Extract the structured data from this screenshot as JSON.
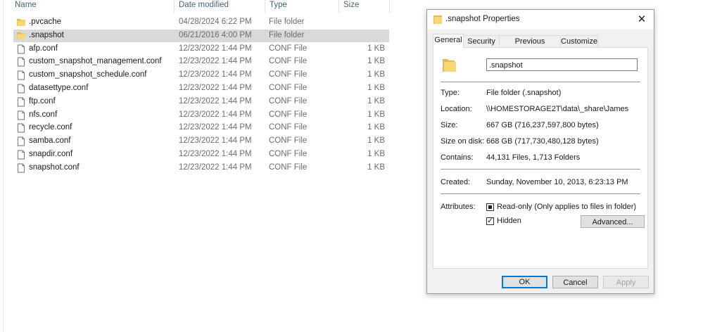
{
  "explorer": {
    "columns": {
      "name": "Name",
      "date": "Date modified",
      "type": "Type",
      "size": "Size"
    },
    "rows": [
      {
        "name": ".pvcache",
        "date": "04/28/2024 6:22 PM",
        "type": "File folder",
        "size": "",
        "icon": "folder-icon"
      },
      {
        "name": ".snapshot",
        "date": "06/21/2016 4:00 PM",
        "type": "File folder",
        "size": "",
        "icon": "folder-icon",
        "selected": true
      },
      {
        "name": "afp.conf",
        "date": "12/23/2022 1:44 PM",
        "type": "CONF File",
        "size": "1 KB",
        "icon": "file-icon"
      },
      {
        "name": "custom_snapshot_management.conf",
        "date": "12/23/2022 1:44 PM",
        "type": "CONF File",
        "size": "1 KB",
        "icon": "file-icon"
      },
      {
        "name": "custom_snapshot_schedule.conf",
        "date": "12/23/2022 1:44 PM",
        "type": "CONF File",
        "size": "1 KB",
        "icon": "file-icon"
      },
      {
        "name": "datasettype.conf",
        "date": "12/23/2022 1:44 PM",
        "type": "CONF File",
        "size": "1 KB",
        "icon": "file-icon"
      },
      {
        "name": "ftp.conf",
        "date": "12/23/2022 1:44 PM",
        "type": "CONF File",
        "size": "1 KB",
        "icon": "file-icon"
      },
      {
        "name": "nfs.conf",
        "date": "12/23/2022 1:44 PM",
        "type": "CONF File",
        "size": "1 KB",
        "icon": "file-icon"
      },
      {
        "name": "recycle.conf",
        "date": "12/23/2022 1:44 PM",
        "type": "CONF File",
        "size": "1 KB",
        "icon": "file-icon"
      },
      {
        "name": "samba.conf",
        "date": "12/23/2022 1:44 PM",
        "type": "CONF File",
        "size": "1 KB",
        "icon": "file-icon"
      },
      {
        "name": "snapdir.conf",
        "date": "12/23/2022 1:44 PM",
        "type": "CONF File",
        "size": "1 KB",
        "icon": "file-icon"
      },
      {
        "name": "snapshot.conf",
        "date": "12/23/2022 1:44 PM",
        "type": "CONF File",
        "size": "1 KB",
        "icon": "file-icon"
      }
    ]
  },
  "dialog": {
    "title": ".snapshot Properties",
    "close_icon": "close-icon",
    "tabs": [
      "General",
      "Security",
      "Previous Versions",
      "Customize"
    ],
    "active_tab": "General",
    "name_value": ".snapshot",
    "fields": {
      "type_label": "Type:",
      "type_value": "File folder (.snapshot)",
      "location_label": "Location:",
      "location_value": "\\\\HOMESTORAGE2T\\data\\_share\\James",
      "size_label": "Size:",
      "size_value": "667 GB (716,237,597,800 bytes)",
      "size_on_disk_label": "Size on disk:",
      "size_on_disk_value": "668 GB (717,730,480,128 bytes)",
      "contains_label": "Contains:",
      "contains_value": "44,131 Files, 1,713 Folders",
      "created_label": "Created:",
      "created_value": "Sunday, November 10, 2013, 6:23:13 PM",
      "attributes_label": "Attributes:"
    },
    "attributes": {
      "readonly_label": "Read-only (Only applies to files in folder)",
      "readonly_state": "indeterminate",
      "hidden_label": "Hidden",
      "hidden_state": "checked",
      "advanced_label": "Advanced..."
    },
    "buttons": {
      "ok": "OK",
      "cancel": "Cancel",
      "apply": "Apply"
    }
  },
  "colors": {
    "folder": "#f8d775",
    "accent": "#0078d7",
    "selected_row": "#d9d9d9"
  }
}
